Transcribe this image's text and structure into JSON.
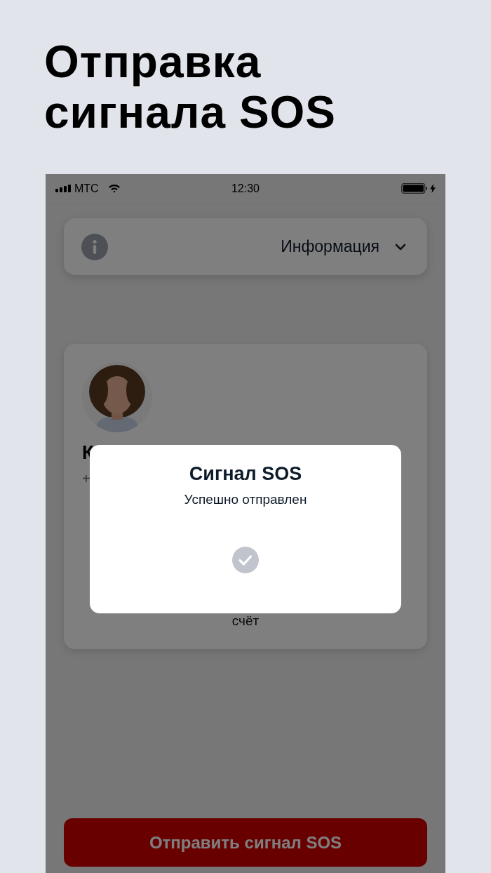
{
  "headline": [
    "Отправка",
    "сигнала SOS"
  ],
  "status_bar": {
    "carrier": "МТС",
    "time": "12:30"
  },
  "info_panel": {
    "label": "Информация",
    "expanded": false
  },
  "profile_card": {
    "name_visible": "К",
    "phone_visible": "+",
    "caption_end": "счёт"
  },
  "dialog": {
    "title": "Сигнал SOS",
    "message": "Успешно отправлен",
    "success": true
  },
  "sos_button": {
    "label": "Отправить сигнал SOS"
  }
}
